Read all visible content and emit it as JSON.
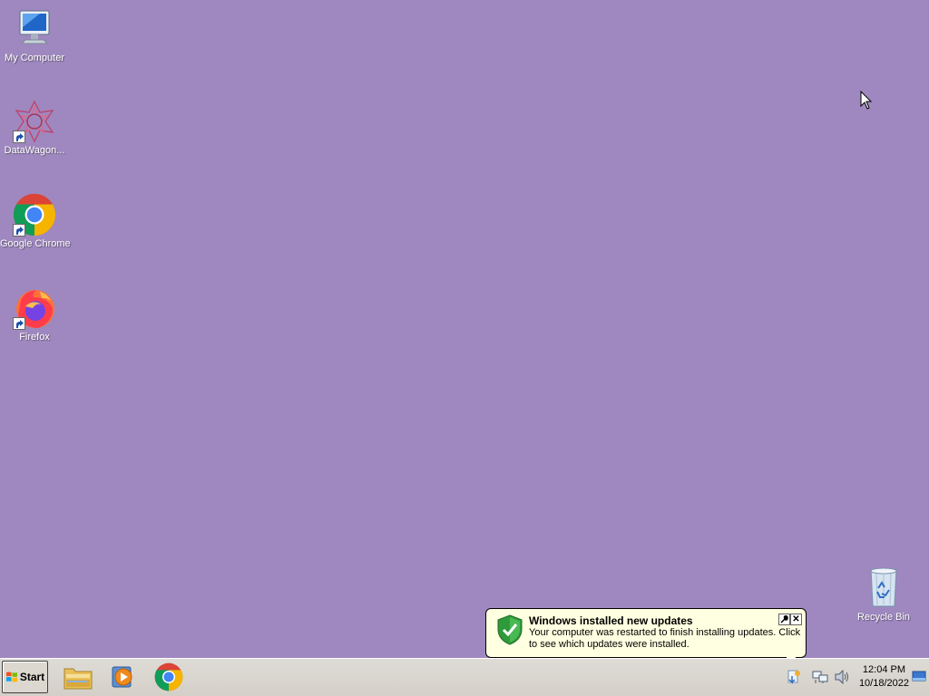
{
  "desktop": {
    "background": "#9f88bf",
    "icons": [
      {
        "label": "My Computer"
      },
      {
        "label": "DataWagon..."
      },
      {
        "label": "Google Chrome"
      },
      {
        "label": "Firefox"
      }
    ],
    "recycle_bin": {
      "label": "Recycle Bin"
    }
  },
  "taskbar": {
    "start_label": "Start",
    "pinned": [
      {
        "icon": "file-explorer-icon"
      },
      {
        "icon": "media-player-icon"
      },
      {
        "icon": "chrome-icon"
      }
    ],
    "clock": {
      "time": "12:04 PM",
      "date": "10/18/2022"
    }
  },
  "notification": {
    "title": "Windows installed new updates",
    "message": "Your computer was restarted to finish installing updates. Click to see which updates were installed.",
    "icon": "security-shield-icon"
  }
}
